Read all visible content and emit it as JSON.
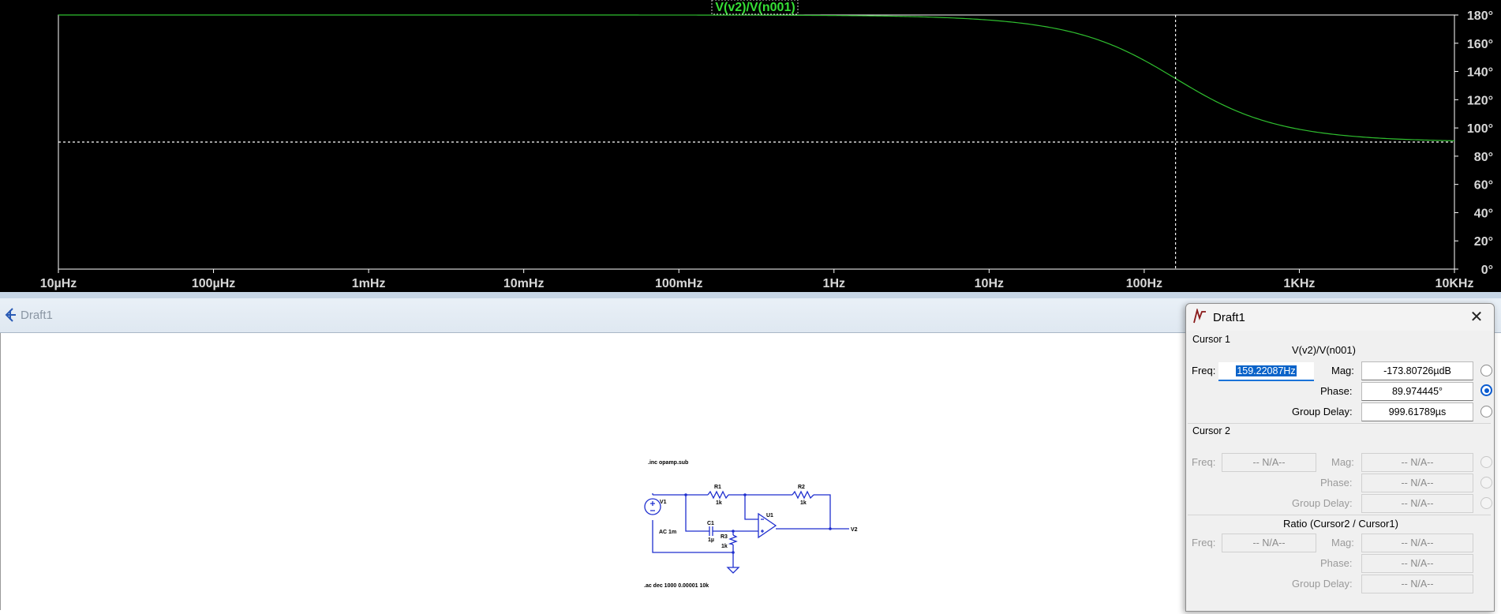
{
  "plot": {
    "trace_name": "V(v2)/V(n001)",
    "x_ticks": [
      "10µHz",
      "100µHz",
      "1mHz",
      "10mHz",
      "100mHz",
      "1Hz",
      "10Hz",
      "100Hz",
      "1KHz",
      "10KHz"
    ],
    "y_ticks": [
      "180°",
      "160°",
      "140°",
      "120°",
      "100°",
      "80°",
      "60°",
      "40°",
      "20°",
      "0°"
    ],
    "colors": {
      "trace": "#2fbf2f",
      "frame": "#ffffff",
      "cursor": "#ffffff",
      "title": "#36e036"
    }
  },
  "chart_data": {
    "type": "line",
    "title": "V(v2)/V(n001)",
    "x_scale": "log",
    "xlim": [
      1e-05,
      10000
    ],
    "ylim": [
      0,
      180
    ],
    "y_unit": "°",
    "grid": false,
    "series": [
      {
        "name": "V(v2)/V(n001)",
        "model": "phase = 180 - atan(f/159.22) (degrees)"
      }
    ],
    "cursor": {
      "x": 159.22087,
      "y": 90
    }
  },
  "schematic_window": {
    "title": "Draft1"
  },
  "schematic": {
    "inc_directive": ".inc opamp.sub",
    "ac_directive": ".ac dec 1000 0.00001 10k",
    "v1_name": "V1",
    "v1_value": "AC 1m",
    "r1_name": "R1",
    "r1_value": "1k",
    "r2_name": "R2",
    "r2_value": "1k",
    "r3_name": "R3",
    "r3_value": "1k",
    "c1_name": "C1",
    "c1_value": "1µ",
    "u1_name": "U1",
    "net_label": "V2",
    "colors": {
      "wire": "#1f2fcf",
      "part": "#1f2fcf"
    }
  },
  "cursor_dialog": {
    "title": "Draft1",
    "close": "✕",
    "cursor1": {
      "group": "Cursor 1",
      "trace": "V(v2)/V(n001)",
      "freq_label": "Freq:",
      "freq": "159.22087Hz",
      "mag_label": "Mag:",
      "mag": "-173.80726µdB",
      "phase_label": "Phase:",
      "phase": "89.974445°",
      "gd_label": "Group Delay:",
      "gd": "999.61789µs"
    },
    "cursor2": {
      "group": "Cursor 2",
      "freq_label": "Freq:",
      "freq": "-- N/A--",
      "mag_label": "Mag:",
      "mag": "-- N/A--",
      "phase_label": "Phase:",
      "phase": "-- N/A--",
      "gd_label": "Group Delay:",
      "gd": "-- N/A--"
    },
    "ratio": {
      "group": "Ratio (Cursor2 / Cursor1)",
      "freq_label": "Freq:",
      "freq": "-- N/A--",
      "mag_label": "Mag:",
      "mag": "-- N/A--",
      "phase_label": "Phase:",
      "phase": "-- N/A--",
      "gd_label": "Group Delay:",
      "gd": "-- N/A--"
    }
  }
}
